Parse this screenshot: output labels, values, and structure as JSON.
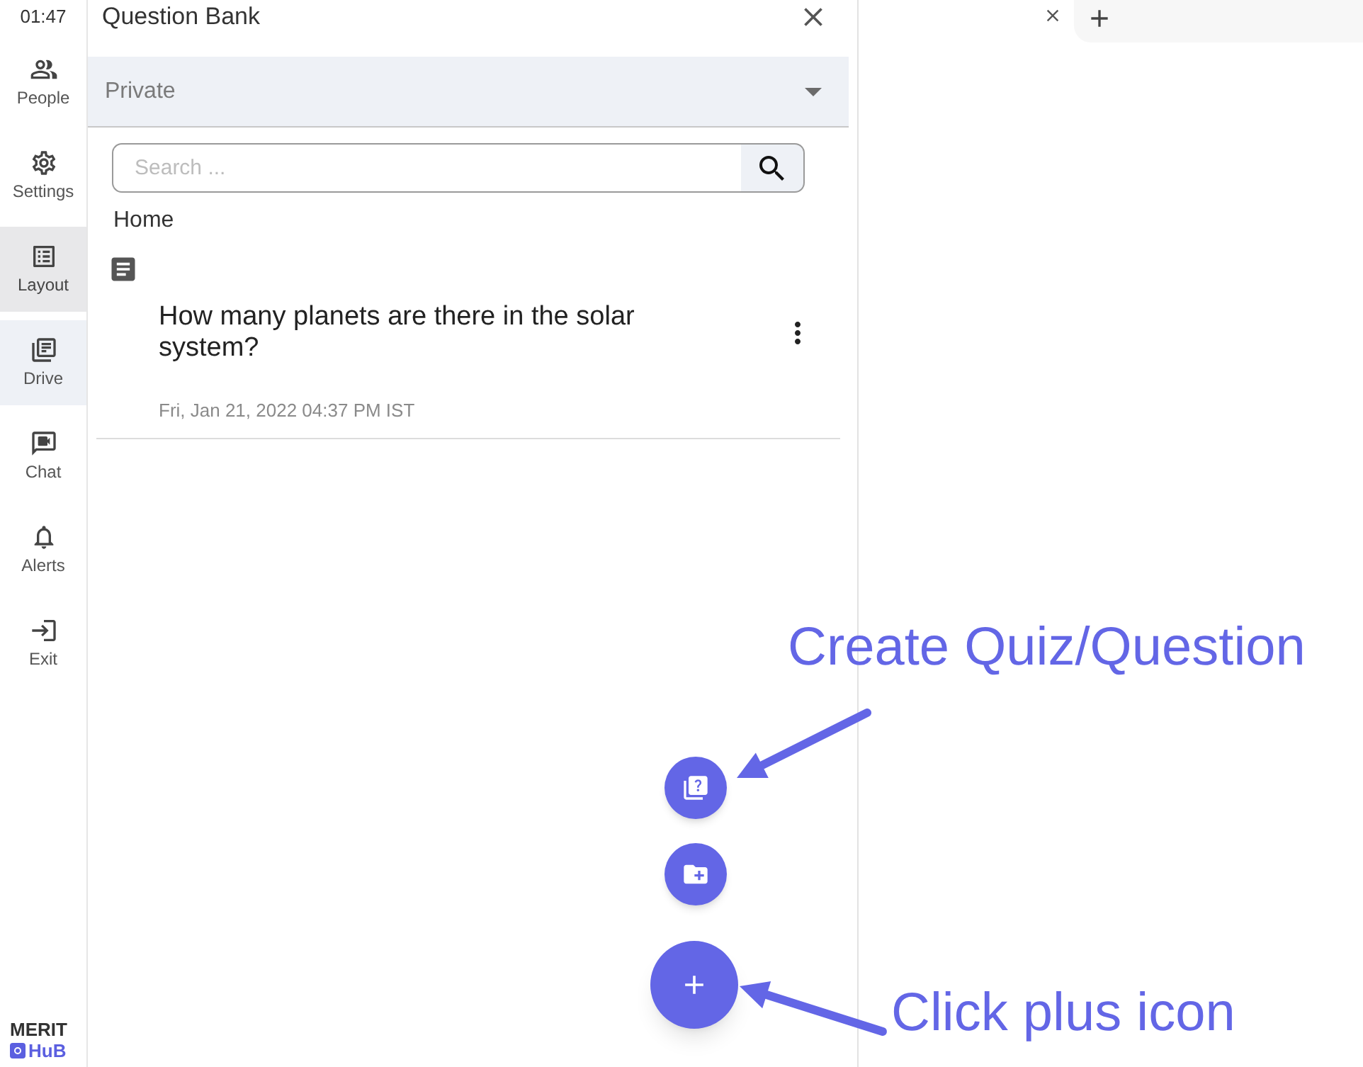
{
  "sidebar": {
    "time": "01:47",
    "items": [
      {
        "label": "People",
        "selected": false,
        "hovered": false
      },
      {
        "label": "Settings",
        "selected": false,
        "hovered": false
      },
      {
        "label": "Layout",
        "selected": true,
        "hovered": false
      },
      {
        "label": "Drive",
        "selected": false,
        "hovered": true
      },
      {
        "label": "Chat",
        "selected": false,
        "hovered": false
      },
      {
        "label": "Alerts",
        "selected": false,
        "hovered": false
      },
      {
        "label": "Exit",
        "selected": false,
        "hovered": false
      }
    ],
    "logo": {
      "top": "MERIT",
      "bottom": "HuB"
    }
  },
  "panel": {
    "title": "Question Bank",
    "filter": {
      "value": "Private"
    },
    "search": {
      "placeholder": "Search ..."
    },
    "breadcrumb": "Home",
    "questions": [
      {
        "text": "How many planets are there in the solar system?",
        "date": "Fri, Jan 21, 2022 04:37 PM IST"
      }
    ]
  },
  "fab_actions": [
    {
      "kind": "quiz"
    },
    {
      "kind": "new_folder"
    }
  ],
  "annotations": [
    {
      "text": "Create Quiz/Question"
    },
    {
      "text": "Click plus icon"
    }
  ]
}
